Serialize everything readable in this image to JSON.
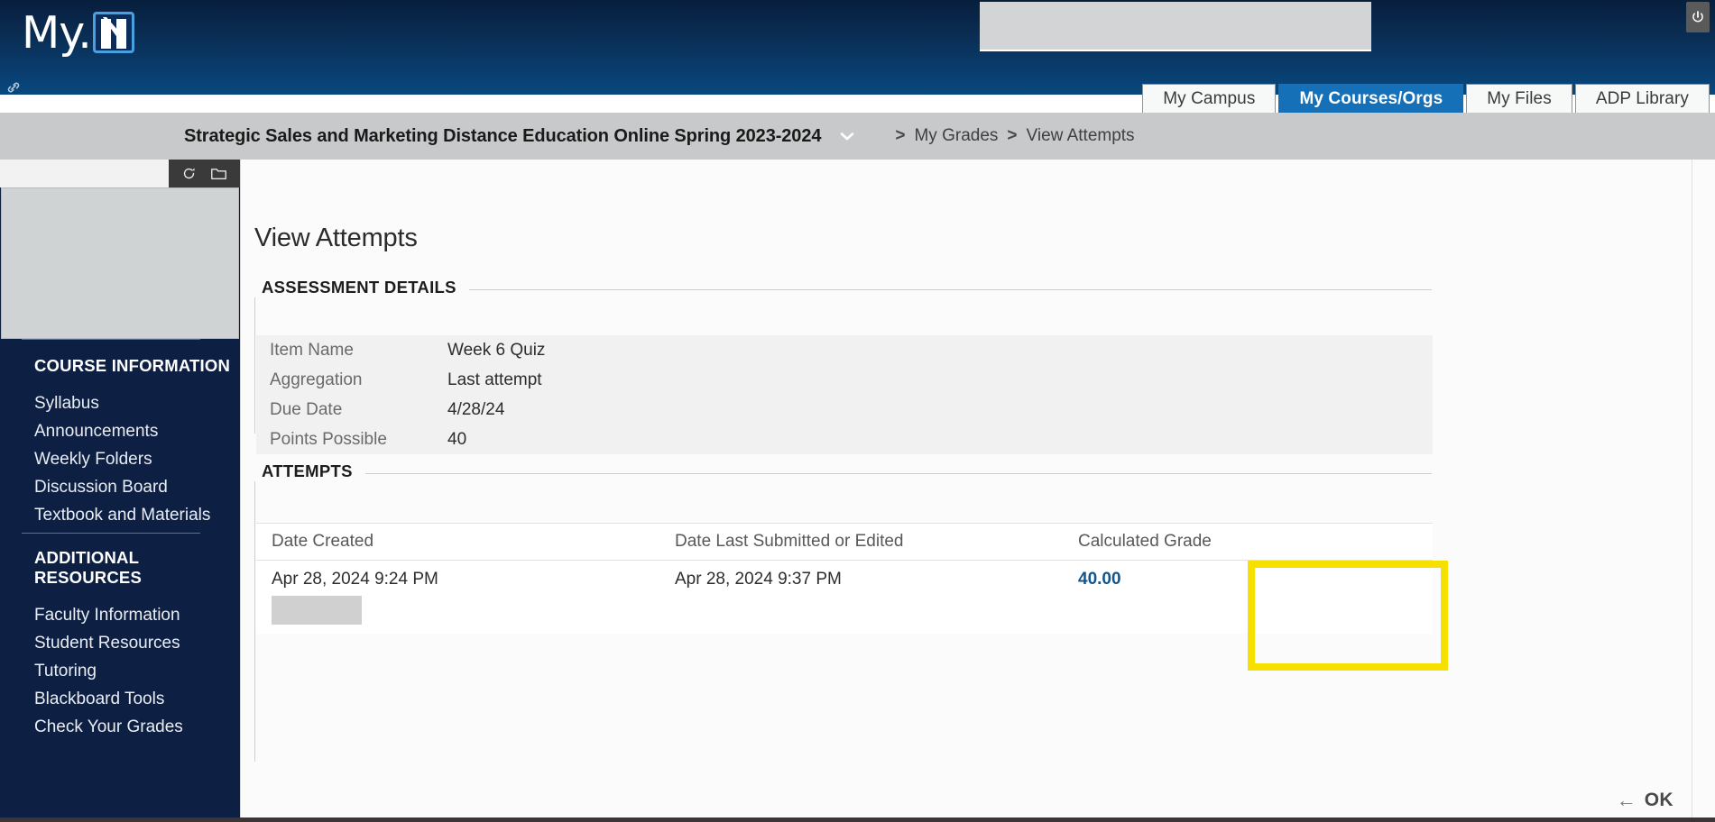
{
  "header": {
    "brand_text": "My.",
    "brand_mark_letter": "N",
    "logout_icon": "power-icon",
    "link_icon": "chain-link-icon"
  },
  "tabs": [
    {
      "label": "My Campus",
      "active": false
    },
    {
      "label": "My Courses/Orgs",
      "active": true
    },
    {
      "label": "My Files",
      "active": false
    },
    {
      "label": "ADP Library",
      "active": false
    }
  ],
  "breadcrumb": {
    "course_title": "Strategic Sales and Marketing Distance Education Online Spring 2023-2024",
    "dropdown_icon": "chevron-down-icon",
    "separator": ">",
    "crumbs": [
      "My Grades",
      "View Attempts"
    ]
  },
  "course_toolbar": {
    "refresh_icon": "refresh-icon",
    "folder_icon": "folder-icon"
  },
  "sidebar": {
    "groups": [
      {
        "header": "COURSE INFORMATION",
        "items": [
          "Syllabus",
          "Announcements",
          "Weekly Folders",
          "Discussion Board",
          "Textbook and Materials"
        ]
      },
      {
        "header": "ADDITIONAL RESOURCES",
        "items": [
          "Faculty Information",
          "Student Resources",
          "Tutoring",
          "Blackboard Tools",
          "Check Your Grades"
        ]
      }
    ]
  },
  "main": {
    "page_title": "View Attempts",
    "assessment": {
      "legend": "ASSESSMENT DETAILS",
      "rows": [
        {
          "label": "Item Name",
          "value": "Week 6 Quiz"
        },
        {
          "label": "Aggregation",
          "value": "Last attempt"
        },
        {
          "label": "Due Date",
          "value": "4/28/24"
        },
        {
          "label": "Points Possible",
          "value": "40"
        }
      ]
    },
    "attempts": {
      "legend": "ATTEMPTS",
      "columns": [
        "Date Created",
        "Date Last Submitted or Edited",
        "Calculated Grade"
      ],
      "rows": [
        {
          "date_created": "Apr 28, 2024 9:24 PM",
          "date_submitted": "Apr 28, 2024 9:37 PM",
          "calculated_grade": "40.00"
        }
      ]
    },
    "ok_button": {
      "arrow": "←",
      "label": "OK"
    }
  },
  "colors": {
    "banner_dark": "#071e3d",
    "banner_light": "#08487f",
    "active_tab": "#1570b8",
    "sidebar": "#0d2044",
    "highlight": "#f5e002",
    "grade_text": "#13558f"
  }
}
